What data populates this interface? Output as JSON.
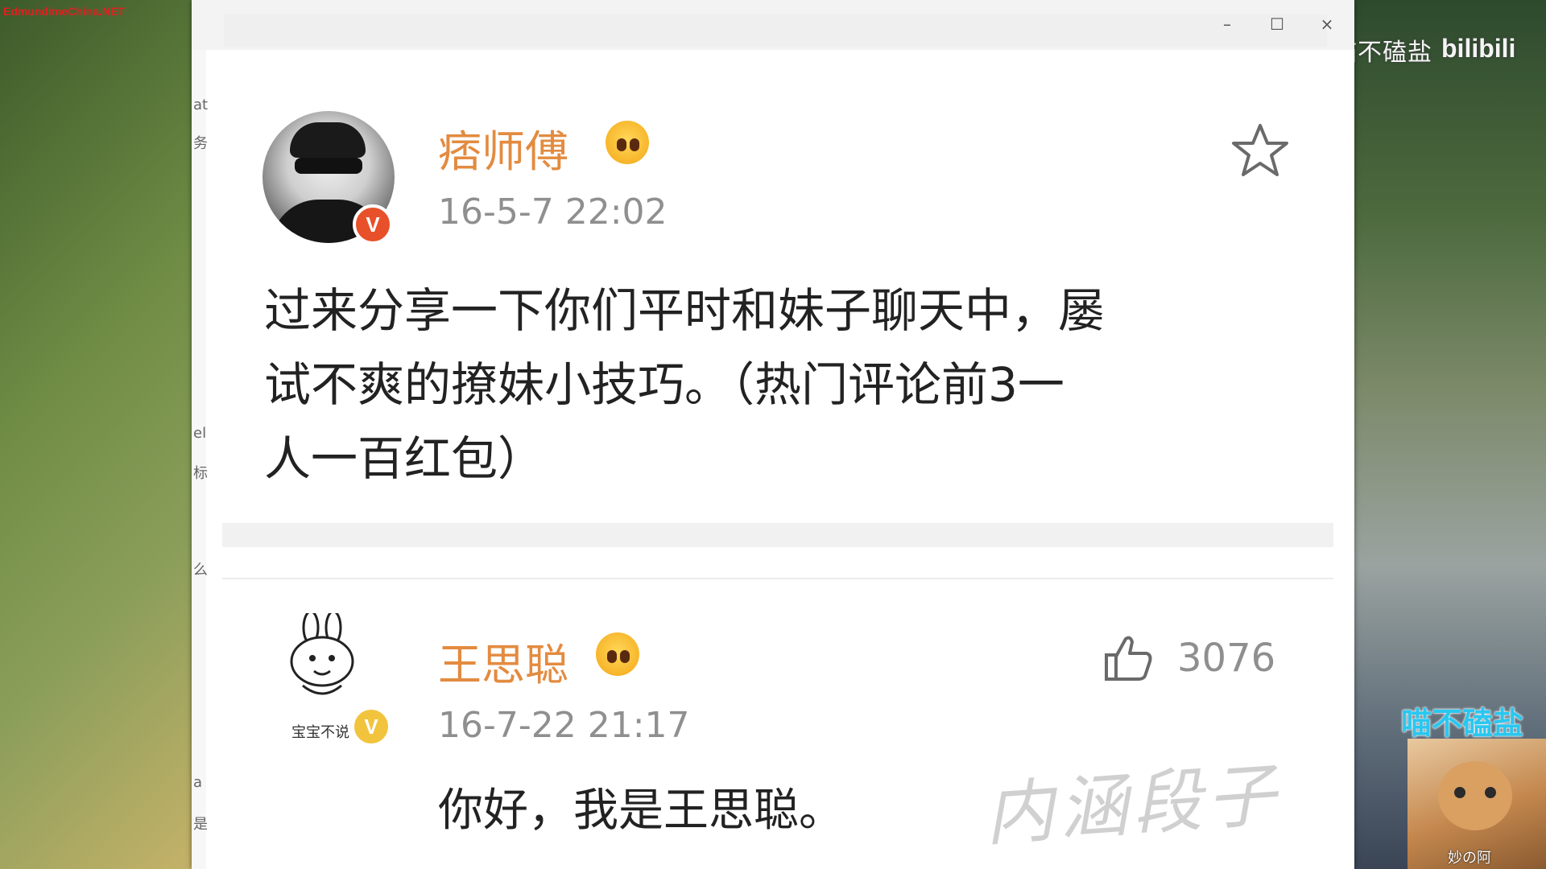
{
  "overlay": {
    "corner_watermark": "EdmundimeChina.NET",
    "channel_brand": "喵不磕盐",
    "platform_logo": "bilibili",
    "uploader_name": "喵不磕盐",
    "cam_label": "妙の阿"
  },
  "window": {
    "controls": {
      "minimize": "–",
      "maximize": "☐",
      "close": "×"
    },
    "left_strip_chars": [
      "at",
      "务",
      "el",
      "标",
      "么",
      "a",
      "是"
    ]
  },
  "post": {
    "author": "痞师傅",
    "verified_badge": "V",
    "timestamp": "16-5-7 22:02",
    "text_lines": [
      "过来分享一下你们平时和妹子聊天中，屡",
      "试不爽的撩妹小技巧。（热门评论前3一",
      "人一百红包）"
    ],
    "favorite_icon": "star-outline-icon",
    "colors": {
      "author": "#e38b40",
      "badge": "#e8502a"
    }
  },
  "comment": {
    "author": "王思聪",
    "avatar_caption": "宝宝不说",
    "verified_badge": "V",
    "timestamp": "16-7-22 21:17",
    "likes": "3076",
    "like_icon": "thumbs-up-icon",
    "text": "你好，我是王思聪。",
    "watermark": "内涵段子",
    "colors": {
      "badge": "#f2c33c"
    }
  }
}
